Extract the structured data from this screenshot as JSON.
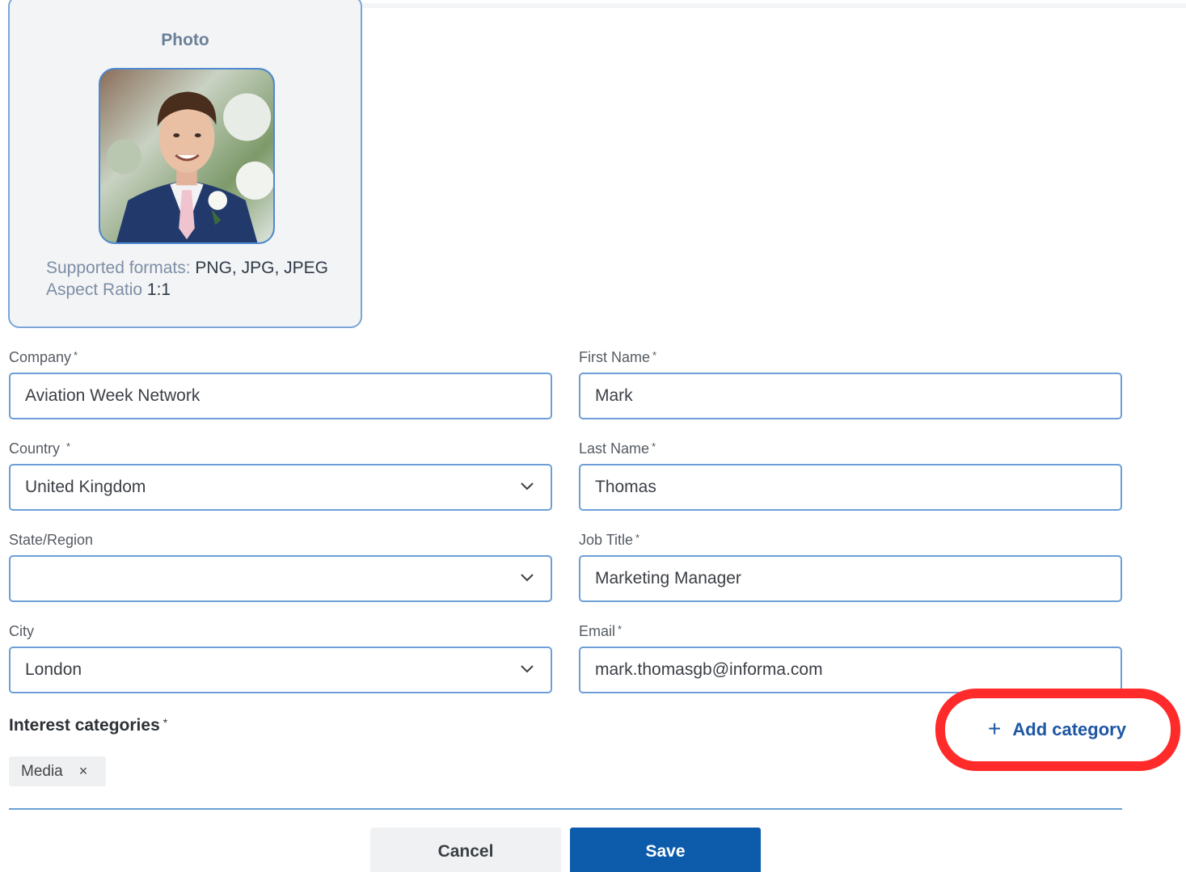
{
  "photo": {
    "title": "Photo",
    "formats_label": "Supported formats:",
    "formats_value": " PNG, JPG, JPEG",
    "aspect_label": "Aspect Ratio",
    "aspect_value": " 1:1"
  },
  "form": {
    "company": {
      "label": "Company",
      "required_mark": "*",
      "value": "Aviation Week Network"
    },
    "country": {
      "label": "Country",
      "required_mark": "*",
      "value": "United Kingdom"
    },
    "state": {
      "label": "State/Region",
      "value": ""
    },
    "city": {
      "label": "City",
      "value": "London"
    },
    "first_name": {
      "label": "First Name",
      "required_mark": "*",
      "value": "Mark"
    },
    "last_name": {
      "label": "Last Name",
      "required_mark": "*",
      "value": "Thomas"
    },
    "job_title": {
      "label": "Job Title",
      "required_mark": "*",
      "value": "Marketing Manager"
    },
    "email": {
      "label": "Email",
      "required_mark": "*",
      "value": "mark.thomasgb@informa.com"
    }
  },
  "interests": {
    "title": "Interest categories",
    "required_mark": "*",
    "chips": [
      {
        "label": "Media",
        "remove": "×"
      }
    ],
    "add_label": "Add category",
    "add_icon": "+"
  },
  "actions": {
    "cancel": "Cancel",
    "save": "Save"
  },
  "colors": {
    "accent": "#0d5bab",
    "input_border": "#6d9fd6",
    "highlight": "#ff2a2a"
  }
}
